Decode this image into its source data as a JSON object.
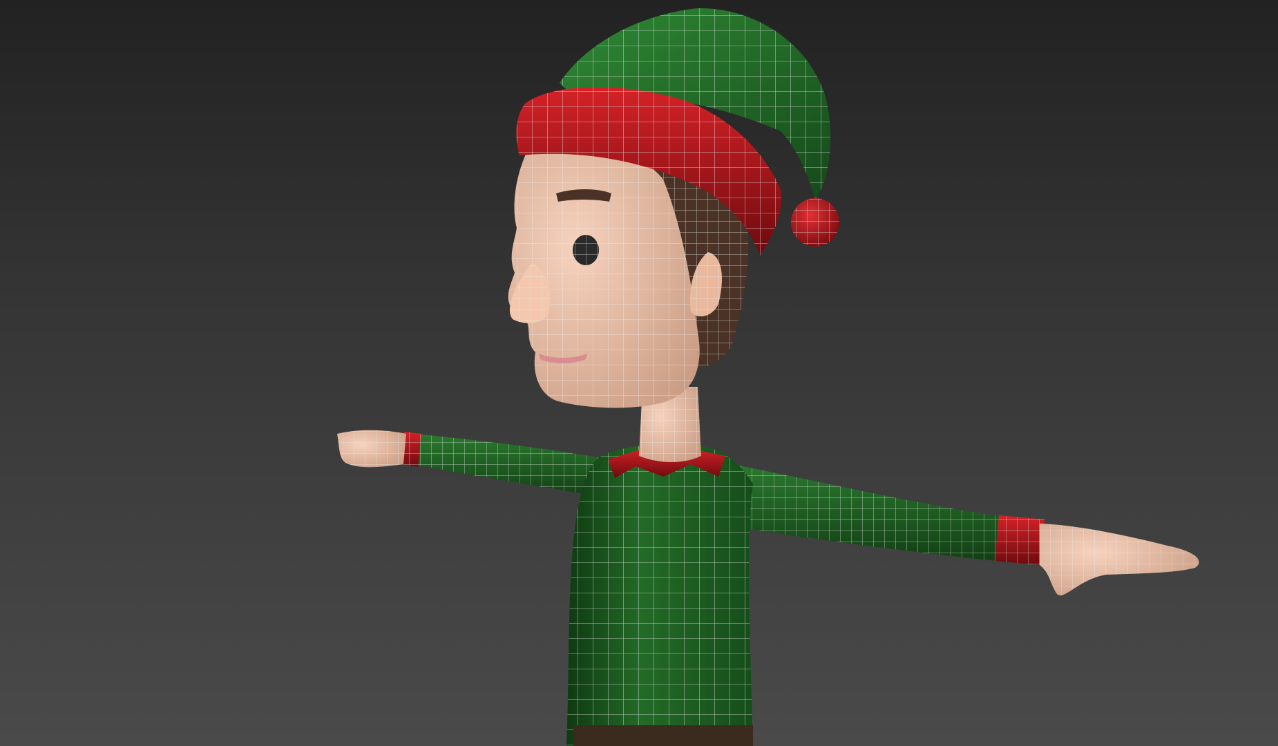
{
  "viewport": {
    "background_top": "#222222",
    "background_bottom": "#4a4a4a",
    "shading_mode": "shaded-with-wireframe",
    "wire_color": "#e6e6e6"
  },
  "model": {
    "pose": "T-pose",
    "materials": {
      "hat": "#1f6a25",
      "hat_band": "#b5161c",
      "pompom": "#c41a1e",
      "skin": "#efc3a9",
      "hair": "#4a3326",
      "sweater": "#1e5e22",
      "cuff": "#b5161c",
      "collar": "#b5161c",
      "belt": "#3b2a1e"
    }
  }
}
